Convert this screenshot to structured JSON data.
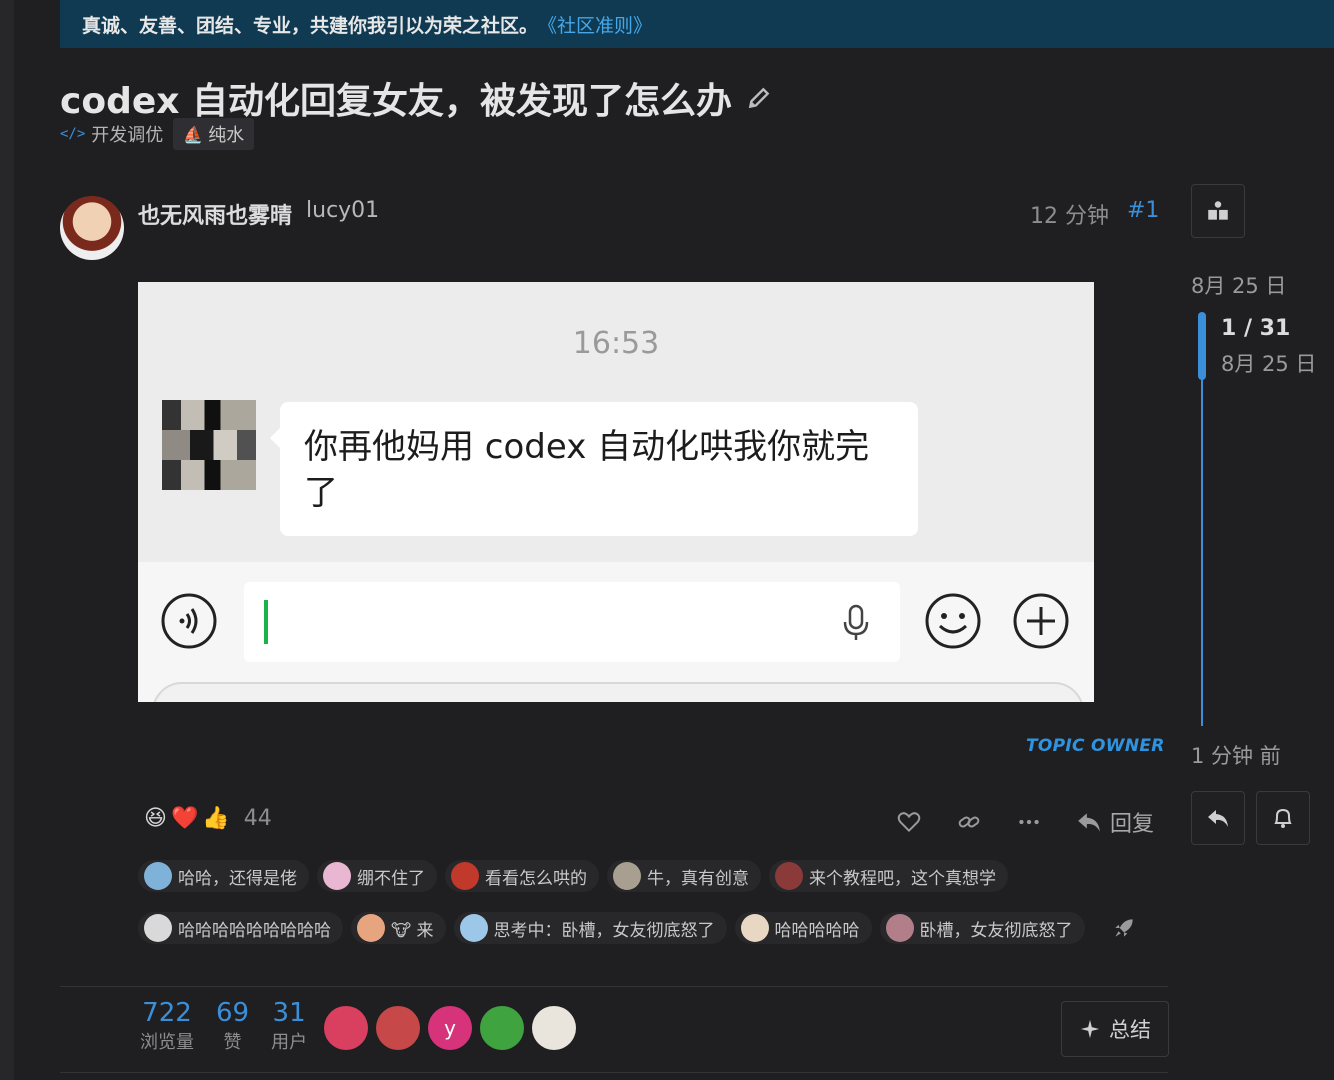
{
  "banner": {
    "text": "真诚、友善、团结、专业，共建你我引以为荣之社区。",
    "link": "《社区准则》"
  },
  "topic": {
    "title": "codex 自动化回复女友，被发现了怎么办",
    "category": "开发调优",
    "tag": "纯水"
  },
  "post": {
    "display_name": "也无风雨也雾晴",
    "username": "lucy01",
    "time": "12 分钟",
    "number": "#1",
    "owner_badge": "TOPIC OWNER"
  },
  "screenshot": {
    "time": "16:53",
    "message": "你再他妈用 codex 自动化哄我你就完了"
  },
  "timeline": {
    "top_date": "8月 25 日",
    "position": "1 / 31",
    "position_date": "8月 25 日",
    "bottom": "1 分钟 前"
  },
  "reactions": {
    "emojis": [
      "😆",
      "❤️",
      "👍"
    ],
    "count": "44"
  },
  "actions": {
    "reply": "回复"
  },
  "chips_row1": [
    {
      "text": "哈哈，还得是佬",
      "color": "#7fb2d9"
    },
    {
      "text": "绷不住了",
      "color": "#e9b7d2"
    },
    {
      "text": "看看怎么哄的",
      "color": "#c0392b"
    },
    {
      "text": "牛，真有创意",
      "color": "#a89f91"
    },
    {
      "text": "来个教程吧，这个真想学",
      "color": "#8b3a3a"
    }
  ],
  "chips_row2": [
    {
      "text": "哈哈哈哈哈哈哈哈哈",
      "color": "#d9d9d9"
    },
    {
      "text": "🐮 来",
      "color": "#e6a57e"
    },
    {
      "text": "思考中：卧槽，女友彻底怒了",
      "color": "#9cc7e8"
    },
    {
      "text": "哈哈哈哈哈",
      "color": "#e8d7c3"
    },
    {
      "text": "卧槽，女友彻底怒了",
      "color": "#b27e8a"
    }
  ],
  "stats": {
    "views": "722",
    "views_label": "浏览量",
    "likes": "69",
    "likes_label": "赞",
    "users": "31",
    "users_label": "用户"
  },
  "participants": [
    {
      "letter": "",
      "color": "#d94060"
    },
    {
      "letter": "",
      "color": "#c64848"
    },
    {
      "letter": "y",
      "color": "#d6337a"
    },
    {
      "letter": "",
      "color": "#3fa33f"
    },
    {
      "letter": "",
      "color": "#e9e4dc"
    }
  ],
  "summary_label": "总结"
}
